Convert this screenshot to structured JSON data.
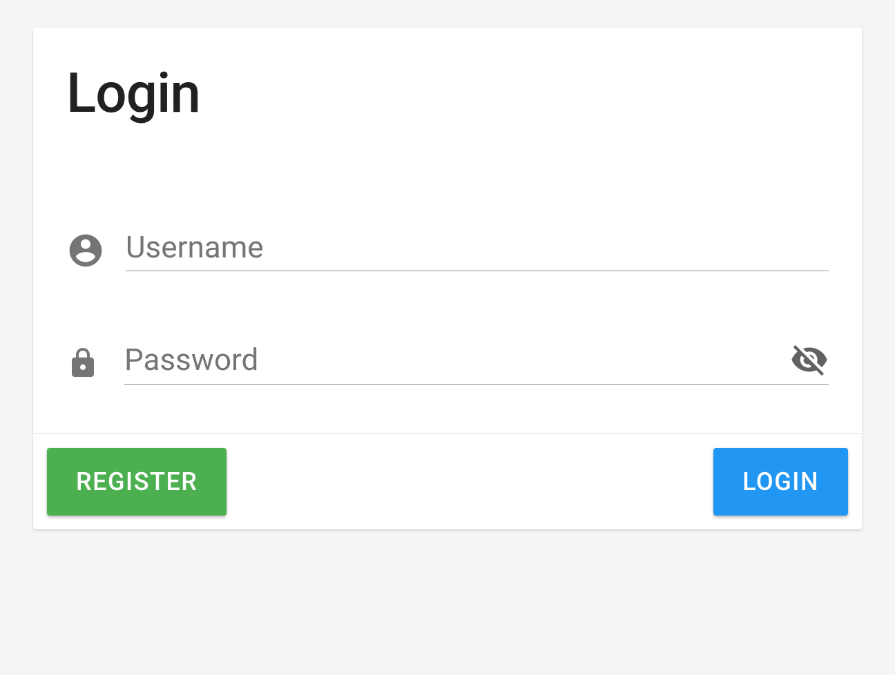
{
  "card": {
    "title": "Login"
  },
  "form": {
    "username": {
      "placeholder": "Username",
      "value": ""
    },
    "password": {
      "placeholder": "Password",
      "value": ""
    }
  },
  "actions": {
    "register_label": "Register",
    "login_label": "Login"
  },
  "colors": {
    "register_bg": "#4caf50",
    "login_bg": "#2196f3",
    "icon_fill": "#757575"
  }
}
